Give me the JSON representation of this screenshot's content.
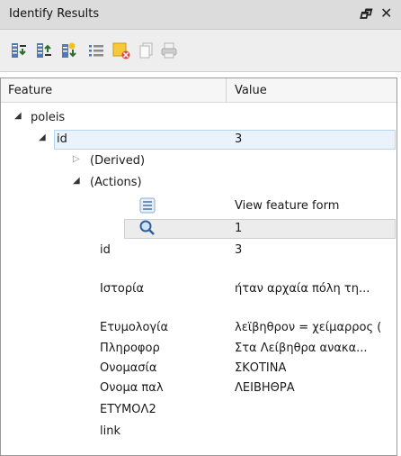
{
  "window": {
    "title": "Identify Results",
    "float_glyph": "🗗",
    "close_glyph": "✕"
  },
  "toolbar": {
    "buttons": [
      {
        "name": "expand-tree-icon"
      },
      {
        "name": "collapse-tree-icon"
      },
      {
        "name": "expand-new-results-icon"
      },
      {
        "name": "open-form-icon"
      },
      {
        "name": "clear-results-icon"
      },
      {
        "name": "copy-feature-icon"
      },
      {
        "name": "print-icon"
      }
    ]
  },
  "table": {
    "headers": {
      "feature": "Feature",
      "value": "Value"
    },
    "layer": {
      "label": "poleis"
    },
    "id_row": {
      "label": "id",
      "value": "3"
    },
    "derived": {
      "label": "(Derived)"
    },
    "actions": {
      "label": "(Actions)"
    },
    "action_form": {
      "value": "View feature form"
    },
    "action_zoom": {
      "value": "1"
    },
    "attributes": [
      {
        "label": "id",
        "value": "3"
      },
      {
        "label": "Ιστορία",
        "value": "ήταν αρχαία πόλη τη..."
      },
      {
        "label": "Ετυμολογία",
        "value": "λεϊβηθρον = χείμαρρος ("
      },
      {
        "label": "Πληροφορ",
        "value": "Στα Λείβηθρα ανακα..."
      },
      {
        "label": "Ονομασία",
        "value": "ΣΚΟΤΙΝΑ"
      },
      {
        "label": "Ονομα παλ",
        "value": "ΛΕΙΒΗΘΡΑ"
      },
      {
        "label": "ΕΤΥΜΟΛ2",
        "value": ""
      },
      {
        "label": "link",
        "value": ""
      }
    ]
  },
  "colors": {
    "titlebar_bg": "#dcdcdc",
    "toolbar_bg": "#eeeeee",
    "selection_bg": "#eaf3fb",
    "selection_border": "#b9d6f0"
  }
}
